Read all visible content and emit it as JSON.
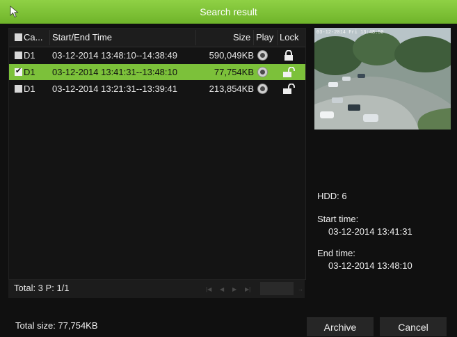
{
  "window": {
    "title": "Search result"
  },
  "table": {
    "headers": {
      "camera": "Ca...",
      "time": "Start/End Time",
      "size": "Size",
      "play": "Play",
      "lock": "Lock"
    },
    "rows": [
      {
        "camera": "D1",
        "time": "03-12-2014 13:48:10--14:38:49",
        "size": "590,049KB",
        "checked": false,
        "locked": true
      },
      {
        "camera": "D1",
        "time": "03-12-2014 13:41:31--13:48:10",
        "size": "77,754KB",
        "checked": true,
        "locked": false
      },
      {
        "camera": "D1",
        "time": "03-12-2014 13:21:31--13:39:41",
        "size": "213,854KB",
        "checked": false,
        "locked": false
      }
    ]
  },
  "preview": {
    "timestamp": "03-12-2014 Fri 13:48:50"
  },
  "details": {
    "hdd": "HDD: 6",
    "start_label": "Start time:",
    "start_value": "03-12-2014 13:41:31",
    "end_label": "End time:",
    "end_value": "03-12-2014 13:48:10"
  },
  "pagination": {
    "total": "Total: 3",
    "page": "P: 1/1",
    "icons": [
      "first-page-icon",
      "prev-page-icon",
      "next-page-icon",
      "last-page-icon",
      "go-arrow-icon"
    ]
  },
  "footer": {
    "total_size": "Total size: 77,754KB"
  },
  "buttons": {
    "archive": "Archive",
    "cancel": "Cancel"
  },
  "colors": {
    "accent": "#7cc13a",
    "title_bar": "#7cc13a",
    "background": "#101010"
  }
}
